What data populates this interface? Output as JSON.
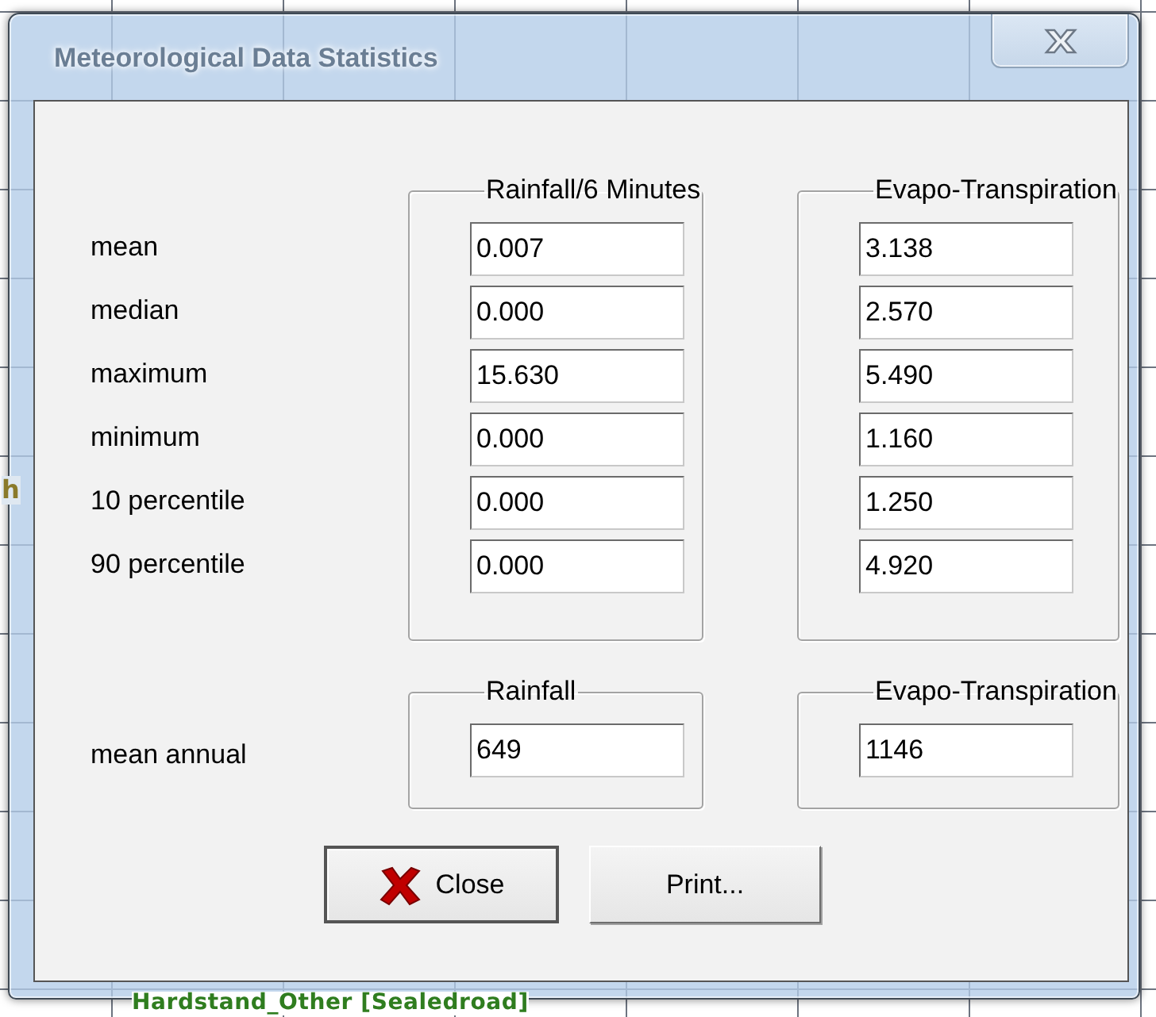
{
  "background": {
    "labels": [
      "h",
      "Hardstand_Other [Sealedroad]"
    ]
  },
  "window": {
    "title": "Meteorological Data Statistics"
  },
  "statistics": {
    "row_labels": [
      "mean",
      "median",
      "maximum",
      "minimum",
      "10 percentile",
      "90 percentile"
    ],
    "groups": [
      {
        "title": "Rainfall/6 Minutes",
        "values": [
          "0.007",
          "0.000",
          "15.630",
          "0.000",
          "0.000",
          "0.000"
        ]
      },
      {
        "title": "Evapo-Transpiration",
        "values": [
          "3.138",
          "2.570",
          "5.490",
          "1.160",
          "1.250",
          "4.920"
        ]
      }
    ]
  },
  "annual": {
    "row_label": "mean annual",
    "groups": [
      {
        "title": "Rainfall",
        "values": [
          "649"
        ]
      },
      {
        "title": "Evapo-Transpiration",
        "values": [
          "1146"
        ]
      }
    ]
  },
  "buttons": [
    {
      "label": "Close",
      "kind": "close",
      "default": true
    },
    {
      "label": "Print...",
      "kind": "plain",
      "default": false
    }
  ]
}
